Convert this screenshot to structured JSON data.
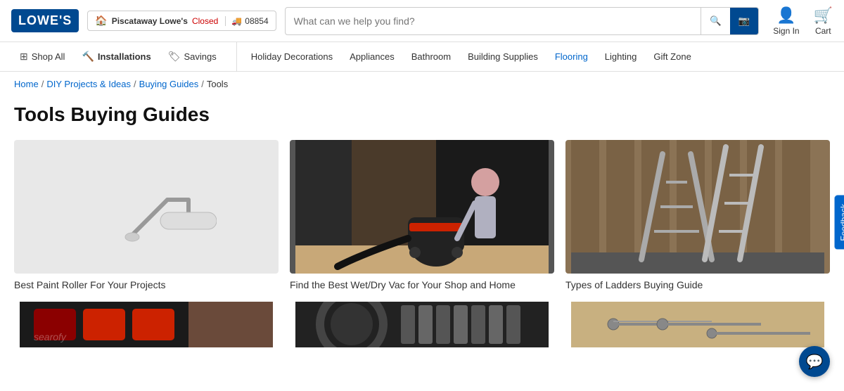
{
  "header": {
    "logo": "LOWE'S",
    "store": {
      "name": "Piscataway Lowe's",
      "status": "Closed",
      "zip": "08854"
    },
    "search": {
      "placeholder": "What can we help you find?"
    },
    "sign_in": "Sign In",
    "cart": "Cart"
  },
  "nav": {
    "primary": [
      {
        "label": "Shop All",
        "icon": "grid"
      },
      {
        "label": "Installations",
        "icon": "hammer"
      },
      {
        "label": "Savings",
        "icon": "tag"
      }
    ],
    "secondary": [
      {
        "label": "Holiday Decorations"
      },
      {
        "label": "Appliances"
      },
      {
        "label": "Bathroom"
      },
      {
        "label": "Building Supplies"
      },
      {
        "label": "Flooring",
        "blue": true
      },
      {
        "label": "Lighting"
      },
      {
        "label": "Gift Zone"
      }
    ]
  },
  "breadcrumb": {
    "items": [
      "Home",
      "DIY Projects & Ideas",
      "Buying Guides",
      "Tools"
    ]
  },
  "page": {
    "title": "Tools Buying Guides"
  },
  "cards": [
    {
      "id": "paint-roller",
      "title": "Best Paint Roller For Your Projects",
      "bg": "#e0e0e0"
    },
    {
      "id": "wet-dry-vac",
      "title": "Find the Best Wet/Dry Vac for Your Shop and Home",
      "bg": "#3a3a3a"
    },
    {
      "id": "ladders",
      "title": "Types of Ladders Buying Guide",
      "bg": "#7a6a55"
    }
  ],
  "cards_bottom": [
    {
      "id": "drill",
      "title": "",
      "bg": "#1a1a1a"
    },
    {
      "id": "tools2",
      "title": "",
      "bg": "#2a2a2a"
    },
    {
      "id": "screws",
      "title": "",
      "bg": "#b8a880"
    }
  ],
  "feedback": "Feedback",
  "chat_icon": "💬"
}
